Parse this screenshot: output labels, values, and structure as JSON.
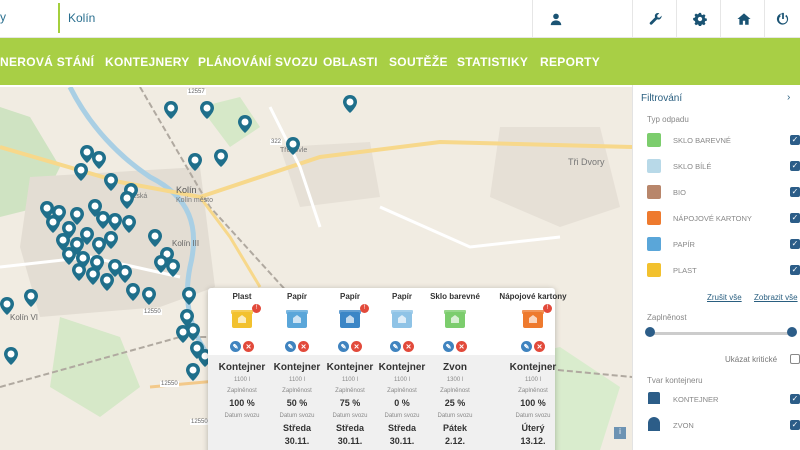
{
  "topbar": {
    "brand_fragment": "y",
    "city": "Kolín",
    "buttons": [
      {
        "name": "user",
        "icon": "user-icon"
      },
      {
        "name": "tools",
        "icon": "wrench-icon"
      },
      {
        "name": "settings",
        "icon": "gear-icon"
      },
      {
        "name": "home",
        "icon": "home-icon"
      },
      {
        "name": "logout",
        "icon": "power-icon"
      }
    ]
  },
  "nav": {
    "items": [
      "NEROVÁ STÁNÍ",
      "KONTEJNERY",
      "PLÁNOVÁNÍ SVOZU",
      "OBLASTI",
      "SOUTĚŽE",
      "STATISTIKY",
      "REPORTY"
    ]
  },
  "map": {
    "labels": {
      "kolin": "Kolín",
      "kolin_vi": "Kolín VI",
      "kolin_iii": "Kolín III",
      "tri_dvory": "Tři Dvory",
      "trebovle": "Třebovle",
      "prazska": "Pražská",
      "kolin_mesto": "Kolín město",
      "r12557": "12557",
      "r322": "322",
      "r12550a": "12550",
      "r12550b": "12550",
      "r12550c": "12550",
      "r3275": "3275",
      "r12545": "12545",
      "rdot": "125"
    },
    "info_label": "i",
    "colors": {
      "pin": "#1f6f8b",
      "selected_pin": "#e2473a"
    }
  },
  "popup": {
    "columns": [
      {
        "name": "Plast",
        "color": "#f2c12e",
        "alert": "!",
        "type": "Kontejner",
        "volume": "1100 l",
        "fill_label": "Zaplněnost",
        "fill": "100 %",
        "date_label": "Datum svozu",
        "day": "",
        "date": ""
      },
      {
        "name": "Papír",
        "color": "#5aa6d9",
        "alert": "",
        "type": "Kontejner",
        "volume": "1100 l",
        "fill_label": "Zaplněnost",
        "fill": "50 %",
        "date_label": "Datum svozu",
        "day": "Středa",
        "date": "30.11."
      },
      {
        "name": "Papír",
        "color": "#3b86c6",
        "alert": "!",
        "type": "Kontejner",
        "volume": "1100 l",
        "fill_label": "Zaplněnost",
        "fill": "75 %",
        "date_label": "Datum svozu",
        "day": "Středa",
        "date": "30.11."
      },
      {
        "name": "Papír",
        "color": "#8fc3e6",
        "alert": "",
        "type": "Kontejner",
        "volume": "1100 l",
        "fill_label": "Zaplněnost",
        "fill": "0 %",
        "date_label": "Datum svozu",
        "day": "Středa",
        "date": "30.11."
      },
      {
        "name": "Sklo barevné",
        "color": "#7ccd6d",
        "alert": "",
        "type": "Zvon",
        "volume": "1300 l",
        "fill_label": "Zaplněnost",
        "fill": "25 %",
        "date_label": "Datum svozu",
        "day": "Pátek",
        "date": "2.12."
      },
      {
        "name": "Nápojové kartony",
        "color": "#ee7a2e",
        "alert": "!",
        "type": "Kontejner",
        "volume": "1100 l",
        "fill_label": "Zaplněnost",
        "fill": "100 %",
        "date_label": "Datum svozu",
        "day": "Úterý",
        "date": "13.12."
      }
    ],
    "edit_glyph": "✎",
    "delete_glyph": "✕"
  },
  "sidebar": {
    "title": "Filtrování",
    "chevron": "›",
    "waste_type_label": "Typ odpadu",
    "waste_types": [
      {
        "label": "SKLO BAREVNÉ",
        "color": "#7ccd6d",
        "checked": true
      },
      {
        "label": "SKLO BÍLÉ",
        "color": "#b8d9e8",
        "checked": true
      },
      {
        "label": "BIO",
        "color": "#b8866b",
        "checked": true
      },
      {
        "label": "NÁPOJOVÉ KARTONY",
        "color": "#ee7a2e",
        "checked": true
      },
      {
        "label": "PAPÍR",
        "color": "#5aa6d9",
        "checked": true
      },
      {
        "label": "PLAST",
        "color": "#f2c12e",
        "checked": true
      }
    ],
    "clear_all": "Zrušit vše",
    "show_all": "Zobrazit vše",
    "fill_label": "Zaplněnost",
    "fill_range": [
      0,
      100
    ],
    "critical_label": "Ukázat kritické",
    "critical_checked": false,
    "shape_label": "Tvar kontejneru",
    "shapes": [
      {
        "label": "KONTEJNER",
        "checked": true
      },
      {
        "label": "ZVON",
        "checked": true
      }
    ],
    "check_glyph": "✓"
  }
}
